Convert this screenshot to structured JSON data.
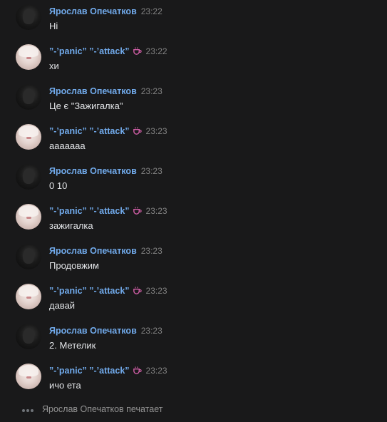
{
  "messages": [
    {
      "author": "Ярослав Опечатков",
      "time": "23:22",
      "text": "Hi",
      "avatar": "dark",
      "emoji": false
    },
    {
      "author": "”-’panic” ”-’attack”",
      "time": "23:22",
      "text": "хи",
      "avatar": "light",
      "emoji": true
    },
    {
      "author": "Ярослав Опечатков",
      "time": "23:23",
      "text": "Це є \"Зажигалка\"",
      "avatar": "dark",
      "emoji": false
    },
    {
      "author": "”-’panic” ”-’attack”",
      "time": "23:23",
      "text": "ааааааа",
      "avatar": "light",
      "emoji": true
    },
    {
      "author": "Ярослав Опечатков",
      "time": "23:23",
      "text": "0 10",
      "avatar": "dark",
      "emoji": false
    },
    {
      "author": "”-’panic” ”-’attack”",
      "time": "23:23",
      "text": "зажигалка",
      "avatar": "light",
      "emoji": true
    },
    {
      "author": "Ярослав Опечатков",
      "time": "23:23",
      "text": "Продовжим",
      "avatar": "dark",
      "emoji": false
    },
    {
      "author": "”-’panic” ”-’attack”",
      "time": "23:23",
      "text": "давай",
      "avatar": "light",
      "emoji": true
    },
    {
      "author": "Ярослав Опечатков",
      "time": "23:23",
      "text": "2. Метелик",
      "avatar": "dark",
      "emoji": false
    },
    {
      "author": "”-’panic” ”-’attack”",
      "time": "23:23",
      "text": "ичо ета",
      "avatar": "light",
      "emoji": true
    }
  ],
  "typing": {
    "text": "Ярослав Опечатков печатает"
  },
  "colors": {
    "background": "#19191a",
    "author": "#71aaeb",
    "time": "#828282",
    "text": "#e1e3e6",
    "emoji": "#d35fa8"
  },
  "icons": {
    "status_emoji": "hot-beverage-icon",
    "typing": "typing-dots-icon"
  }
}
